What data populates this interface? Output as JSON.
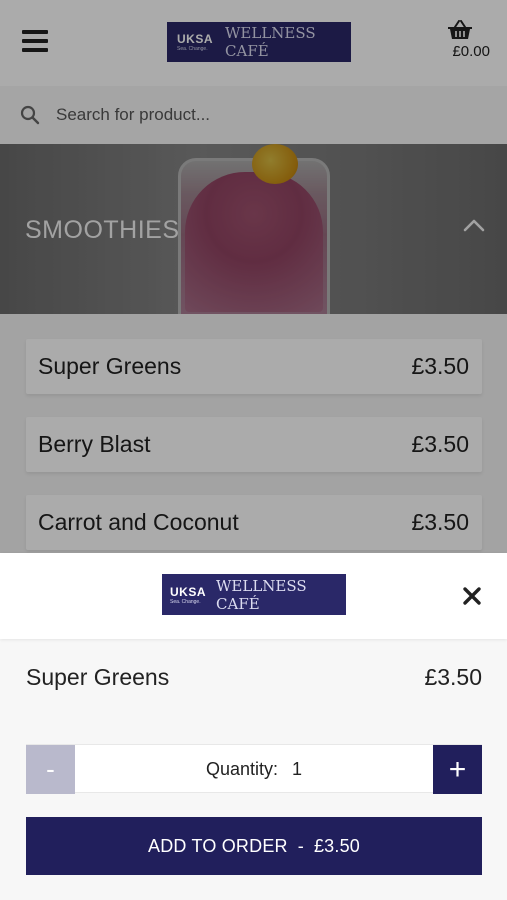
{
  "header": {
    "logo": {
      "brand": "UKSA",
      "tagline": "Sea. Change.",
      "name": "WELLNESS CAFÉ"
    },
    "cart_total": "£0.00",
    "icons": {
      "menu": "hamburger-menu-icon",
      "cart": "basket-icon"
    }
  },
  "search": {
    "placeholder": "Search for product...",
    "icon": "search-icon"
  },
  "category": {
    "title": "SMOOTHIES",
    "icon": "chevron-up-icon"
  },
  "products": [
    {
      "name": "Super Greens",
      "price": "£3.50"
    },
    {
      "name": "Berry Blast",
      "price": "£3.50"
    },
    {
      "name": "Carrot and Coconut",
      "price": "£3.50"
    }
  ],
  "sheet": {
    "logo": {
      "brand": "UKSA",
      "tagline": "Sea. Change.",
      "name": "WELLNESS CAFÉ"
    },
    "close_icon": "close-icon",
    "product_name": "Super Greens",
    "product_price": "£3.50",
    "quantity_label": "Quantity:",
    "quantity_value": "1",
    "minus_label": "-",
    "plus_label": "+",
    "add_label": "ADD TO ORDER",
    "add_separator": "-",
    "add_price": "£3.50"
  },
  "colors": {
    "brand_navy": "#211f5c",
    "disabled_button": "#b9b9cc"
  }
}
